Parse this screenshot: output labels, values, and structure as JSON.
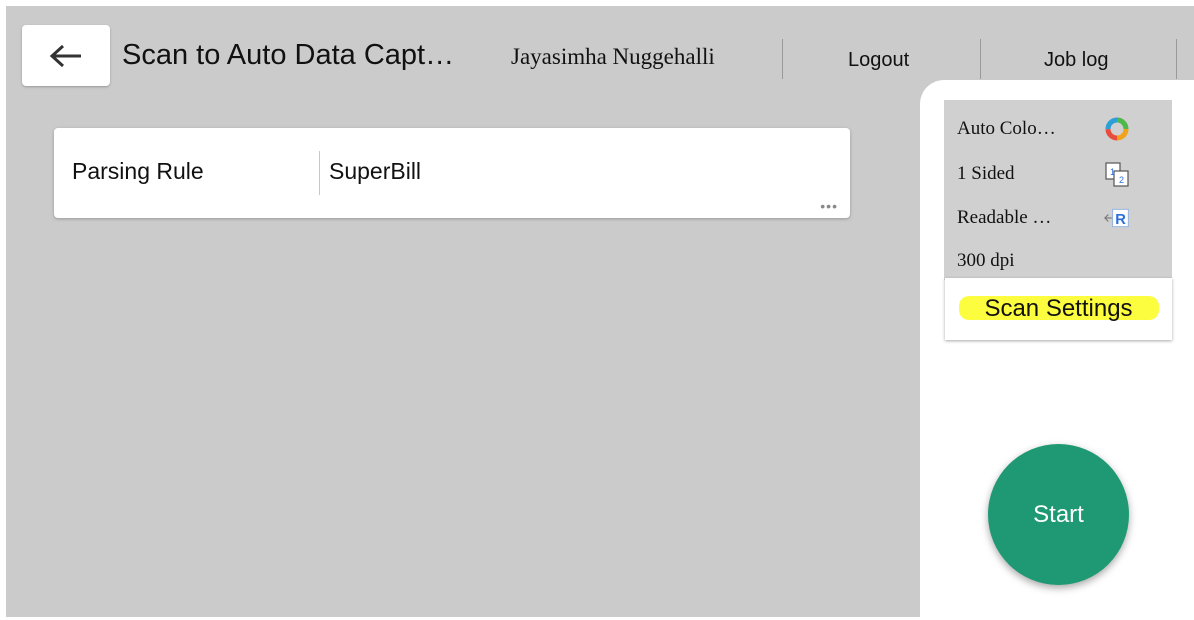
{
  "header": {
    "title": "Scan to Auto Data Capt…",
    "user_name": "Jayasimha Nuggehalli",
    "logout_label": "Logout",
    "job_log_label": "Job log",
    "back_icon": "arrow-left-icon"
  },
  "main": {
    "field_label": "Parsing Rule",
    "field_value": "SuperBill",
    "more_indicator": "•••"
  },
  "scan_settings_summary": {
    "items": [
      {
        "label": "Auto Colo…",
        "icon": "color-mode-icon"
      },
      {
        "label": "1 Sided",
        "icon": "one-sided-icon"
      },
      {
        "label": "Readable …",
        "icon": "orientation-icon"
      },
      {
        "label": "300 dpi",
        "icon": ""
      }
    ]
  },
  "scan_settings_button_label": "Scan Settings",
  "start_label": "Start",
  "colors": {
    "background": "#cbcbcb",
    "start_button": "#1e9973",
    "highlight": "#fdfd3f"
  }
}
